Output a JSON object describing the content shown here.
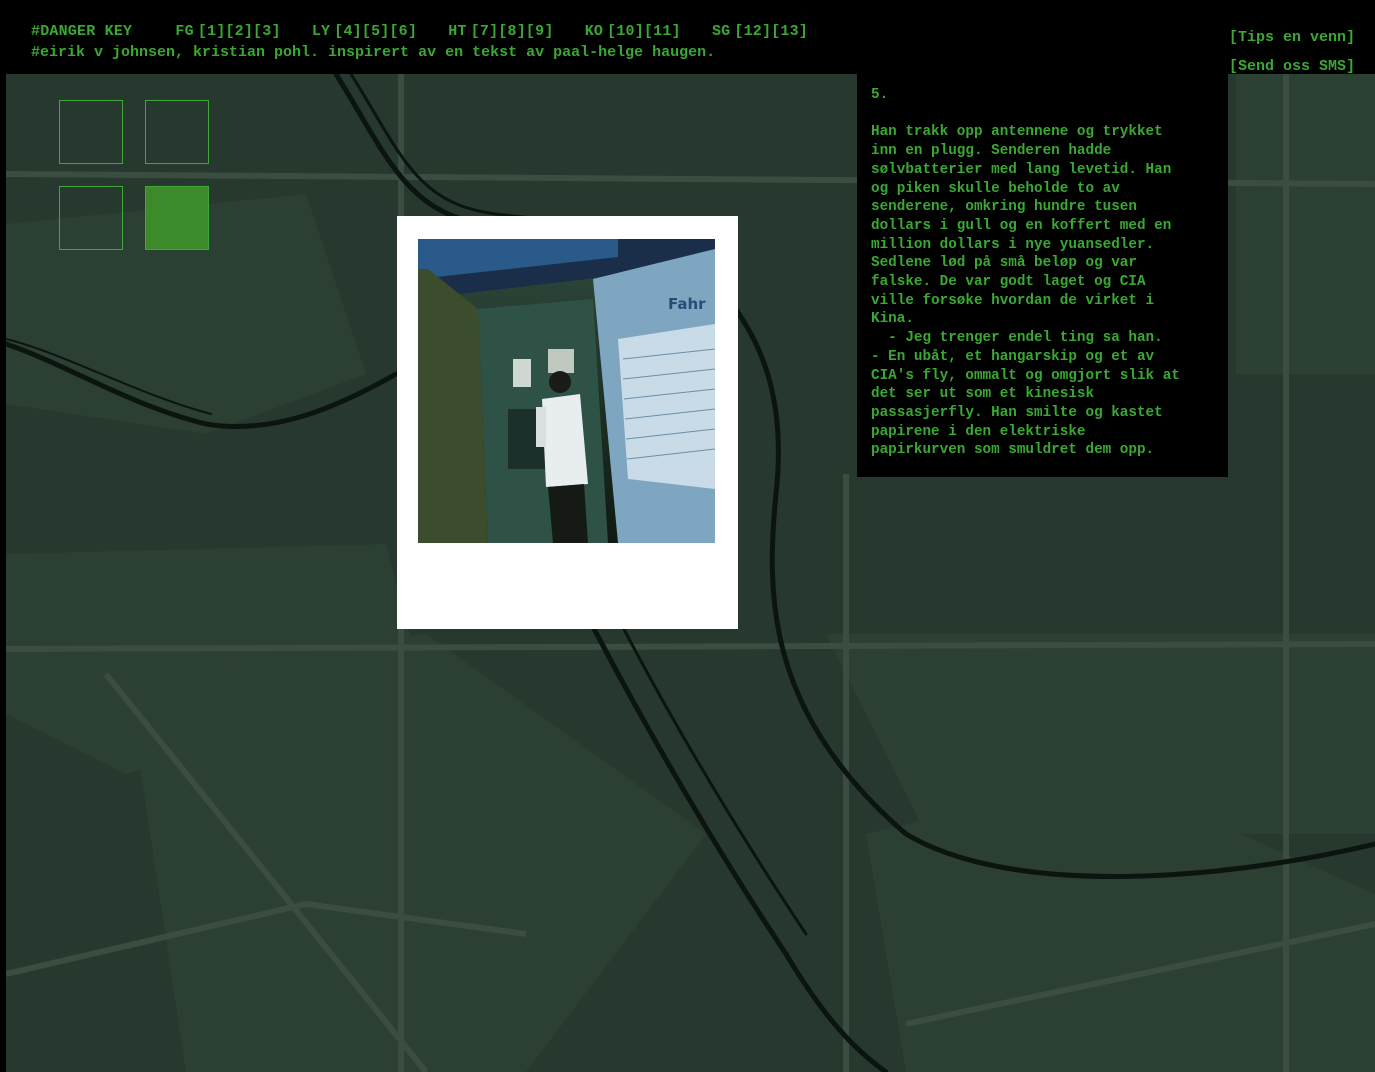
{
  "header": {
    "site_title": "#DANGER KEY",
    "nav_groups": [
      {
        "code": "FG",
        "links": [
          "[1]",
          "[2]",
          "[3]"
        ]
      },
      {
        "code": "LY",
        "links": [
          "[4]",
          "[5]",
          "[6]"
        ]
      },
      {
        "code": "HT",
        "links": [
          "[7]",
          "[8]",
          "[9]"
        ]
      },
      {
        "code": "KO",
        "links": [
          "[10]",
          "[11]"
        ]
      },
      {
        "code": "SG",
        "links": [
          "[12]",
          "[13]"
        ]
      }
    ],
    "credits": "#eirik v johnsen, kristian pohl. inspirert av en tekst av paal-helge haugen.",
    "tips_link": "[Tips en venn]",
    "sms_link": "[Send oss SMS]"
  },
  "grid": {
    "squares": [
      {
        "active": false
      },
      {
        "active": false
      },
      {
        "active": false
      },
      {
        "active": true
      }
    ]
  },
  "photo": {
    "sign_text": "Fahr"
  },
  "story": {
    "number": "5.",
    "text": "Han trakk opp antennene og trykket\ninn en plugg. Senderen hadde\nsølvbatterier med lang levetid. Han\nog piken skulle beholde to av\nsenderene, omkring hundre tusen\ndollars i gull og en koffert med en\nmillion dollars i nye yuansedler.\nSedlene lød på små beløp og var\nfalske. De var godt laget og CIA\nville forsøke hvordan de virket i\nKina.\n  - Jeg trenger endel ting sa han.\n- En ubåt, et hangarskip og et av\nCIA's fly, ommalt og omgjort slik at\ndet ser ut som et kinesisk\npassasjerfly. Han smilte og kastet\npapirene i den elektriske\npapirkurven som smuldret dem opp."
  },
  "colors": {
    "accent": "#3aa832",
    "map": "#27382e",
    "active_square": "#3d8a2a"
  }
}
